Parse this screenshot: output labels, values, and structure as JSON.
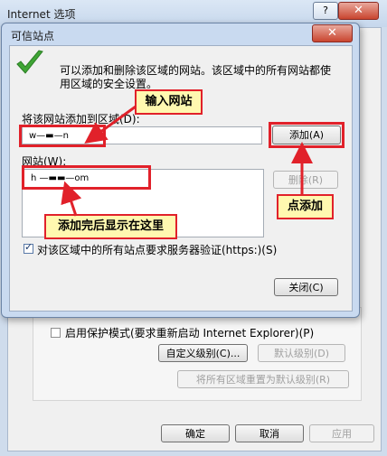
{
  "outer_window": {
    "title": "Internet 选项",
    "help_label": "?",
    "close_label": "✕",
    "protected_mode_label": "启用保护模式(要求重新启动 Internet Explorer)(P)",
    "custom_level_label": "自定义级别(C)...",
    "default_level_label": "默认级别(D)",
    "reset_all_label": "将所有区域重置为默认级别(R)",
    "ok_label": "确定",
    "cancel_label": "取消",
    "apply_label": "应用"
  },
  "dialog": {
    "title": "可信站点",
    "close_label": "✕",
    "description_line1": "可以添加和删除该区域的网站。该区域中的所有网站都使",
    "description_line2": "用区域的安全设置。",
    "add_label": "将该网站添加到区域(D):",
    "add_input_value": "w—▬—n",
    "add_button_label": "添加(A)",
    "websites_label": "网站(W):",
    "site_entry": "h  —▬▬—om",
    "remove_button_label": "删除(R)",
    "https_checkbox_label": "对该区域中的所有站点要求服务器验证(https:)(S)",
    "https_checked": true,
    "close_button_label": "关闭(C)"
  },
  "annotations": {
    "enter_site": "输入网站",
    "click_add": "点添加",
    "shown_after_add": "添加完后显示在这里",
    "accent_color": "#e1212a",
    "callout_color": "#fff8b0"
  }
}
